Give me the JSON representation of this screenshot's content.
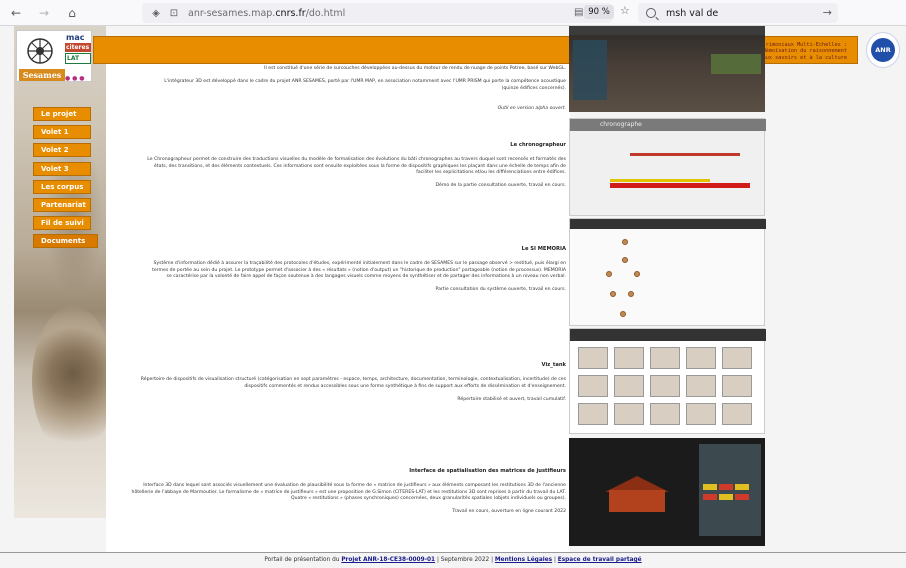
{
  "browser": {
    "url_prefix": "anr-sesames.map.",
    "url_domain": "cnrs.fr",
    "url_path": "/do.html",
    "zoom": "90 %",
    "search_text": "msh val de"
  },
  "banner": {
    "line1": "Documentation Et Spatialisation d'Artefacts patrimoniaux Multi-Echelles :",
    "line2": "annotation 3D, Sémantisation et Mémoïsation du raisonnement",
    "line3": "CES 38 La Révolution numérique : rapports aux savoirs et à la culture"
  },
  "logo": {
    "title": "Sesames",
    "partners": [
      "mac",
      "citeres",
      "LAT"
    ]
  },
  "menu": [
    "Le projet",
    "Volet 1",
    "Volet 2",
    "Volet 3",
    "Les corpus",
    "Partenariat",
    "Fil de suivi",
    "Documents"
  ],
  "sections": {
    "integrator": {
      "p1": "Il est constitué d'une série de surcouches développées au-dessus du moteur de rendu de nuage de points Potree, basé sur WebGL.",
      "p2": "L'intégrateur 3D est développé dans le cadre du projet ANR SESAMES, porté par l'UMR MAP, en association notamment avec l'UMR PRISM qui porte la compétence acoustique (quinze édifices concernés).",
      "p3": "Outil en version alpha ouvert."
    },
    "chronographe": {
      "title": "Le chronographeur",
      "p1": "Le Chronographeur permet de construire des traductions visuelles du modèle de formalisation des évolutions du bâti chronographes au travers duquel sont recensés et formatés des états, des transitions, et des éléments contextuels. Ces informations sont ensuite exploitées sous la forme de dispositifs graphiques les plaçant dans une échelle de temps afin de faciliter les explicitations et/ou les différenciations entre édifices.",
      "p2": "Démo de la partie consultation ouverte, travail en cours."
    },
    "memoria": {
      "title": "Le SI MEMORIA",
      "p1": "Système d'information dédié à assurer la traçabilité des protocoles d'études, expérimenté initialement dans le cadre de SESAMES sur le passage observé > restitué, puis élargi en termes de portée au sein du projet. Le prototype permet d'associer à des « résultats » (notion d'output) un \"historique de production\" partageable (notion de processus). MEMORIA se caractérise par la volonté de faire appel de façon soutenue à des langages visuels comme moyens de synthétiser et de partager des informations à un niveau non verbal.",
      "p2": "Partie consultation du système ouverte, travail en cours."
    },
    "viz": {
      "title": "Viz_tank",
      "p1": "Répertoire de dispositifs de visualisation structuré (catégorisation en sept paramètres - espace, temps, architecture, documentation, terminologie, contextualisation, incertitude) de ces dispositifs commentés et rendus accessibles sous une forme synthétique à fins de support aux efforts de dissémination et d'enseignement.",
      "p2": "Répertoire stabilisé et ouvert, travail cumulatif."
    },
    "interface": {
      "title": "Interface de spatialisation des matrices de justifieurs",
      "p1": "Interface 3D dans lequel sont associés visuellement une évaluation de plausibilité sous la forme de « matrice de justifieurs » aux éléments composant les restitutions 3D de l'ancienne hôtellerie de l'abbaye de Marmoutier. Le formalisme de « matrice de justifieurs » est une proposition de G.Simon (CITERES-LAT) et les restitutions 3D sont reprises à partir du travail du LAT. Quatre « restitutions » (phases synchroniques) concernées, deux granularités spatiales (objets individuels ou groupes).",
      "p2": "Travail en cours, ouverture en ligne courant 2022"
    }
  },
  "footer": {
    "prefix": "Portail de présentation du",
    "project_link": "Projet ANR-18-CE38-0009-01",
    "date": "| Septembre 2022 |",
    "legal_link": "Mentions Légales",
    "sep": "|",
    "workspace_link": "Espace de travail partagé"
  },
  "colors": {
    "accent_orange": "#e98d00",
    "banner_text": "#6b1d1d",
    "link": "#1a1a8a"
  }
}
